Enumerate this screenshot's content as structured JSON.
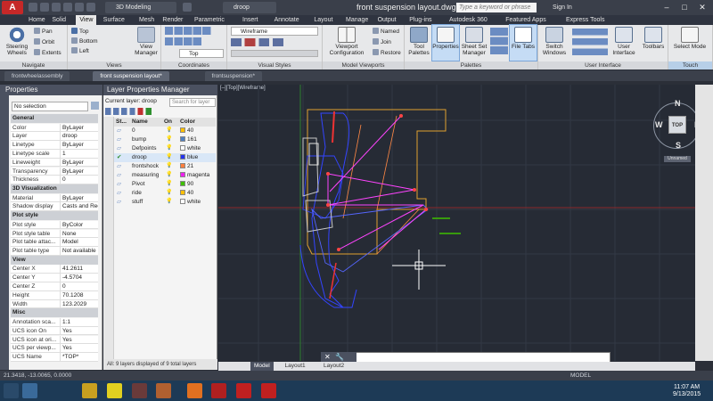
{
  "app": {
    "title": "front suspension layout.dwg",
    "app_button": "A",
    "workspace": "3D Modeling",
    "layer_current": "droop",
    "search_placeholder": "Type a keyword or phrase",
    "sign_in": "Sign In",
    "window_controls": [
      "–",
      "□",
      "✕"
    ]
  },
  "menu_tabs": [
    "Home",
    "Solid",
    "View",
    "Surface",
    "Mesh",
    "Render",
    "Parametric",
    "Insert",
    "Annotate",
    "Layout",
    "Manage",
    "Output",
    "Plug-ins",
    "Autodesk 360",
    "Featured Apps",
    "Express Tools"
  ],
  "active_menu_tab": "View",
  "ribbon": {
    "navigate": {
      "label": "Navigate",
      "steering": "Steering Wheels",
      "pan": "Pan",
      "orbit": "Orbit",
      "extents": "Extents"
    },
    "views": {
      "label": "Views",
      "top": "Top",
      "bottom": "Bottom",
      "left": "Left",
      "view_manager": "View Manager"
    },
    "coordinates": {
      "label": "Coordinates",
      "ucs_dropdown": "Top"
    },
    "visual_styles": {
      "label": "Visual Styles",
      "dropdown": "Wireframe"
    },
    "model_viewports": {
      "label": "Model Viewports",
      "config": "Viewport Configuration",
      "named": "Named",
      "join": "Join",
      "restore": "Restore"
    },
    "palettes": {
      "label": "Palettes",
      "tool": "Tool Palettes",
      "properties": "Properties",
      "sheet_set": "Sheet Set Manager",
      "file_tabs": "File Tabs"
    },
    "user_interface": {
      "label": "User Interface",
      "switch": "Switch Windows",
      "user_iface": "User Interface",
      "toolbars": "Toolbars"
    },
    "touch": {
      "label": "Touch",
      "select_mode": "Select Mode"
    }
  },
  "doc_tabs": [
    "frontwheelassembly",
    "front suspension layout*",
    "frontsuspension*"
  ],
  "active_doc_tab": 1,
  "properties": {
    "title": "Properties",
    "selection": "No selection",
    "sections": [
      {
        "name": "General",
        "rows": [
          [
            "Color",
            "ByLayer"
          ],
          [
            "Layer",
            "droop"
          ],
          [
            "Linetype",
            "ByLayer"
          ],
          [
            "Linetype scale",
            "1"
          ],
          [
            "Lineweight",
            "ByLayer"
          ],
          [
            "Transparency",
            "ByLayer"
          ],
          [
            "Thickness",
            "0"
          ]
        ]
      },
      {
        "name": "3D Visualization",
        "rows": [
          [
            "Material",
            "ByLayer"
          ],
          [
            "Shadow display",
            "Casts and Rec..."
          ]
        ]
      },
      {
        "name": "Plot style",
        "rows": [
          [
            "Plot style",
            "ByColor"
          ],
          [
            "Plot style table",
            "None"
          ],
          [
            "Plot table attac...",
            "Model"
          ],
          [
            "Plot table type",
            "Not available"
          ]
        ]
      },
      {
        "name": "View",
        "rows": [
          [
            "Center X",
            "41.2611"
          ],
          [
            "Center Y",
            "-4.5704"
          ],
          [
            "Center Z",
            "0"
          ],
          [
            "Height",
            "70.1208"
          ],
          [
            "Width",
            "123.2029"
          ]
        ]
      },
      {
        "name": "Misc",
        "rows": [
          [
            "Annotation sca...",
            "1:1"
          ],
          [
            "UCS icon On",
            "Yes"
          ],
          [
            "UCS icon at ori...",
            "Yes"
          ],
          [
            "UCS per viewp...",
            "Yes"
          ],
          [
            "UCS Name",
            "*TOP*"
          ]
        ]
      }
    ]
  },
  "layers": {
    "title": "Layer Properties Manager",
    "current_label": "Current layer: droop",
    "search_placeholder": "Search for layer",
    "columns": [
      "St...",
      "Name",
      "On",
      "Color"
    ],
    "rows": [
      {
        "name": "0",
        "color": "40",
        "hex": "#ffbf00",
        "current": false
      },
      {
        "name": "bump",
        "color": "161",
        "hex": "#4f7fbf",
        "current": false
      },
      {
        "name": "Defpoints",
        "color": "white",
        "hex": "#ffffff",
        "current": false
      },
      {
        "name": "droop",
        "color": "blue",
        "hex": "#2233ee",
        "current": true
      },
      {
        "name": "frontshock",
        "color": "21",
        "hex": "#ff7f3f",
        "current": false
      },
      {
        "name": "measuring",
        "color": "magenta",
        "hex": "#ee22ee",
        "current": false
      },
      {
        "name": "Pivot",
        "color": "90",
        "hex": "#3fbf00",
        "current": false
      },
      {
        "name": "ride",
        "color": "40",
        "hex": "#ffbf00",
        "current": false
      },
      {
        "name": "stuff",
        "color": "white",
        "hex": "#ffffff",
        "current": false
      }
    ],
    "footer": "All: 9 layers displayed of 9 total layers"
  },
  "viewport": {
    "label": "[–][Top][Wireframe]",
    "viewcube": {
      "face": "TOP",
      "n": "N",
      "s": "S",
      "e": "E",
      "w": "W",
      "ucs": "Unnamed"
    }
  },
  "layout_tabs": [
    "Model",
    "Layout1",
    "Layout2"
  ],
  "status": {
    "coords": "21.3418, -13.0065, 0.0000",
    "model": "MODEL"
  },
  "clock": {
    "time": "11:07 AM",
    "date": "9/13/2015"
  }
}
